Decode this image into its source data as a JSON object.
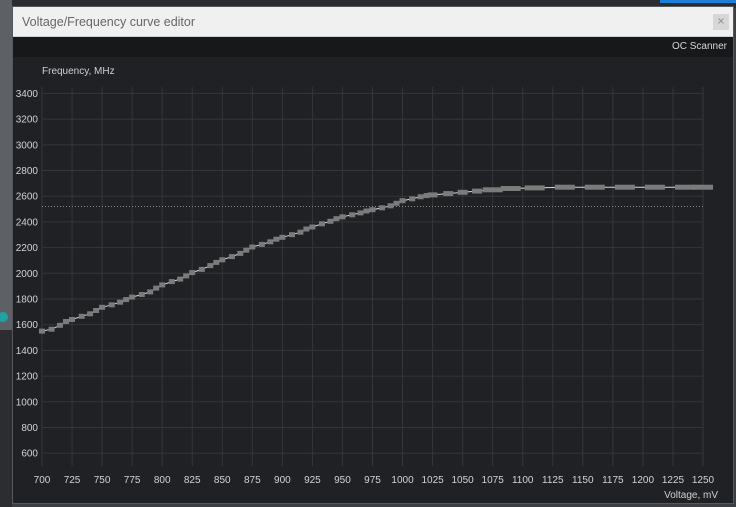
{
  "window": {
    "title": "Voltage/Frequency curve editor",
    "close_label": "×",
    "oc_scanner_label": "OC Scanner"
  },
  "colors": {
    "grid": "#34363a",
    "curve": "#d9d9d9",
    "points": "#7b7b7b",
    "reference_line": "#8a8a8a",
    "accent_teal": "#1fa3a3"
  },
  "chart_data": {
    "type": "line",
    "xlabel": "Voltage, mV",
    "ylabel": "Frequency, MHz",
    "xlim": [
      700,
      1250
    ],
    "ylim": [
      500,
      3450
    ],
    "x_ticks": [
      700,
      725,
      750,
      775,
      800,
      825,
      850,
      875,
      900,
      925,
      950,
      975,
      1000,
      1025,
      1050,
      1075,
      1100,
      1125,
      1150,
      1175,
      1200,
      1225,
      1250
    ],
    "y_ticks": [
      600,
      800,
      1000,
      1200,
      1400,
      1600,
      1800,
      2000,
      2200,
      2400,
      2600,
      2800,
      3000,
      3200,
      3400
    ],
    "grid": true,
    "reference_line_mhz": 2520,
    "series": [
      {
        "x": [
          700,
          708,
          715,
          720,
          725,
          733,
          740,
          745,
          750,
          758,
          765,
          770,
          775,
          783,
          790,
          795,
          800,
          808,
          815,
          820,
          825,
          833,
          840,
          845,
          850,
          858,
          865,
          870,
          875,
          883,
          890,
          895,
          900,
          908,
          915,
          920,
          925,
          933,
          940,
          945,
          950,
          958,
          965,
          970,
          975,
          983,
          990,
          995,
          1000,
          1008,
          1015,
          1020,
          1025,
          1038,
          1050,
          1062,
          1075,
          1090,
          1110,
          1135,
          1160,
          1185,
          1210,
          1235,
          1250
        ],
        "y": [
          1550,
          1565,
          1595,
          1625,
          1640,
          1665,
          1685,
          1710,
          1735,
          1755,
          1775,
          1795,
          1815,
          1835,
          1855,
          1885,
          1910,
          1935,
          1955,
          1980,
          2005,
          2030,
          2060,
          2085,
          2105,
          2130,
          2155,
          2180,
          2205,
          2225,
          2245,
          2265,
          2280,
          2300,
          2320,
          2345,
          2360,
          2385,
          2405,
          2425,
          2440,
          2455,
          2470,
          2485,
          2495,
          2510,
          2525,
          2545,
          2565,
          2580,
          2595,
          2605,
          2610,
          2620,
          2630,
          2640,
          2650,
          2660,
          2665,
          2670,
          2670,
          2670,
          2670,
          2670,
          2670
        ]
      }
    ]
  }
}
